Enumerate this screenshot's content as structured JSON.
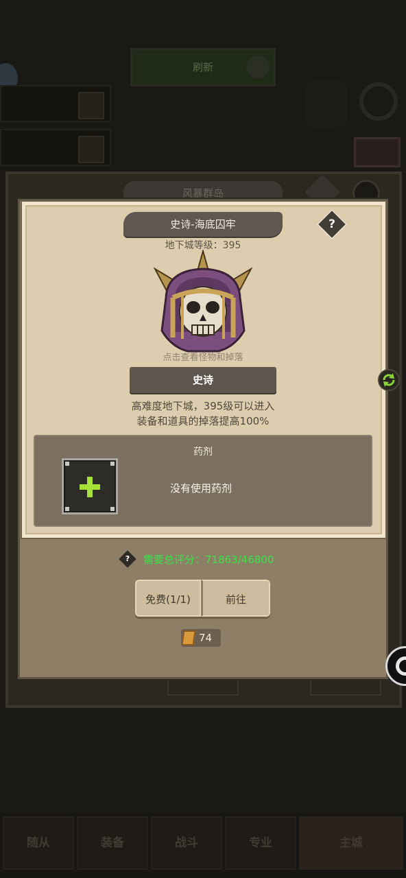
{
  "background": {
    "top_bar_label": "刷新",
    "left_tags": [
      "",
      ""
    ],
    "robot_label": "",
    "panel_title": "风暴群岛",
    "bottom_buttons": [
      "",
      ""
    ],
    "nav_items": [
      "随从",
      "装备",
      "战斗",
      "专业",
      "主城"
    ]
  },
  "modal": {
    "title": "史诗-海底囚牢",
    "help_symbol": "?",
    "dungeon_level": "地下城等级：395",
    "hint": "点击查看怪物和掉落",
    "difficulty": "史诗",
    "description_line1": "高难度地下城，395级可以进入",
    "description_line2": "装备和道具的掉落提高100%",
    "potion": {
      "title": "药剂",
      "empty_text": "没有使用药剂"
    },
    "score": {
      "help_symbol": "?",
      "text": "需要总评分：71863/46800"
    },
    "buttons": {
      "free": "免费(1/1)",
      "go": "前往"
    },
    "cost": "74"
  },
  "colors": {
    "score_green": "#3fe04a",
    "plus_green": "#a8e03a",
    "parchment": "#dccdaf"
  }
}
